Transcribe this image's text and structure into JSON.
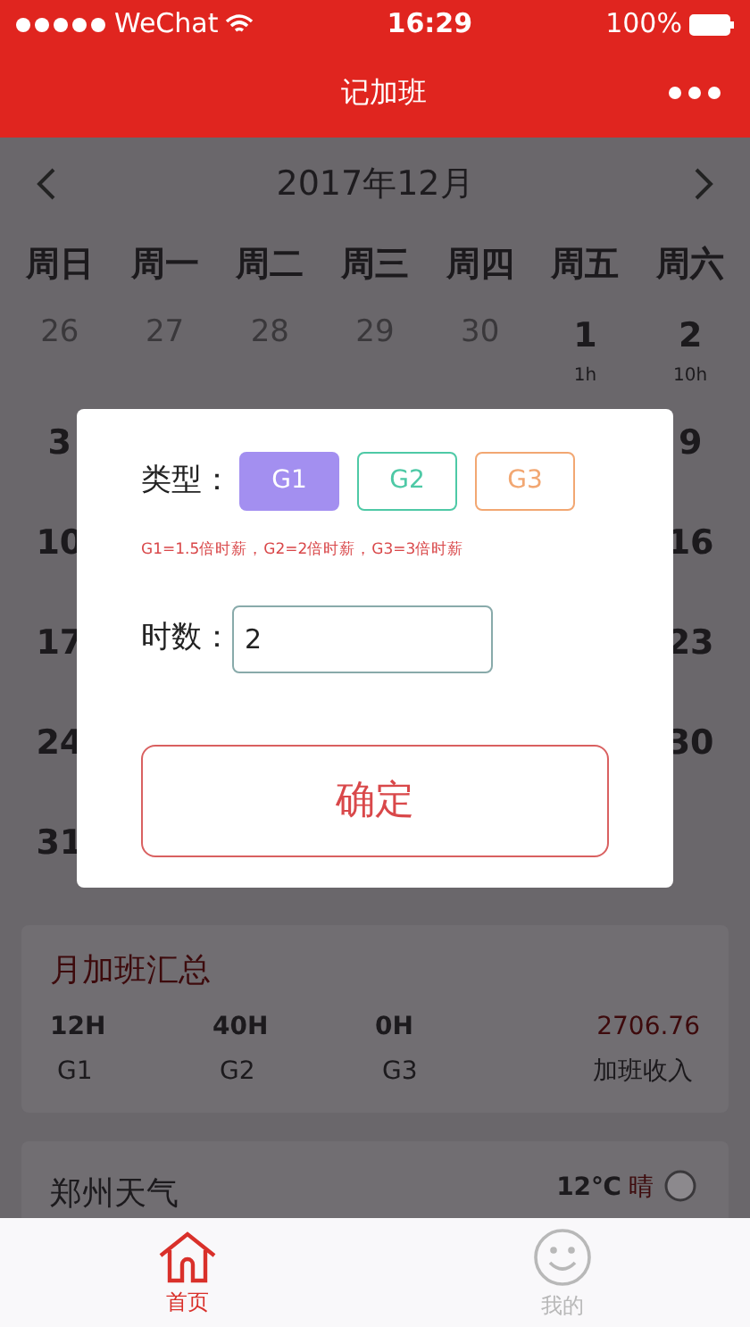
{
  "status_bar": {
    "carrier": "WeChat",
    "time": "16:29",
    "battery": "100%"
  },
  "nav": {
    "title": "记加班"
  },
  "calendar": {
    "month": "2017年12月",
    "weekdays": [
      "周日",
      "周一",
      "周二",
      "周三",
      "周四",
      "周五",
      "周六"
    ],
    "first_row": [
      {
        "day": "26",
        "faded": true
      },
      {
        "day": "27",
        "faded": true
      },
      {
        "day": "28",
        "faded": true
      },
      {
        "day": "29",
        "faded": true
      },
      {
        "day": "30",
        "faded": true
      },
      {
        "day": "1",
        "faded": false,
        "sub": "1h"
      },
      {
        "day": "2",
        "faded": false,
        "sub": "10h"
      }
    ],
    "rows": [
      {
        "first": "3",
        "last": "9"
      },
      {
        "first": "10",
        "last": "16"
      },
      {
        "first": "17",
        "last": "23"
      },
      {
        "first": "24",
        "last": "30"
      },
      {
        "first": "31"
      }
    ]
  },
  "dialog": {
    "type_label": "类型：",
    "types": [
      {
        "label": "G1",
        "selected": true,
        "color": "#a38ff0"
      },
      {
        "label": "G2",
        "selected": false,
        "color": "#4ec9a6"
      },
      {
        "label": "G3",
        "selected": false,
        "color": "#f2a772"
      }
    ],
    "hint": "G1=1.5倍时薪，G2=2倍时薪，G3=3倍时薪",
    "hours_label": "时数：",
    "hours": "2",
    "confirm": "确定"
  },
  "summary": {
    "title": "月加班汇总",
    "items": [
      {
        "value": "12H",
        "label": "G1"
      },
      {
        "value": "40H",
        "label": "G2"
      },
      {
        "value": "0H",
        "label": "G3"
      },
      {
        "value": "2706.76",
        "label": "加班收入"
      }
    ]
  },
  "weather": {
    "title": "郑州天气",
    "temp": "12℃",
    "condition": "晴"
  },
  "tabs": [
    {
      "label": "首页",
      "selected": true
    },
    {
      "label": "我的",
      "selected": false
    }
  ]
}
